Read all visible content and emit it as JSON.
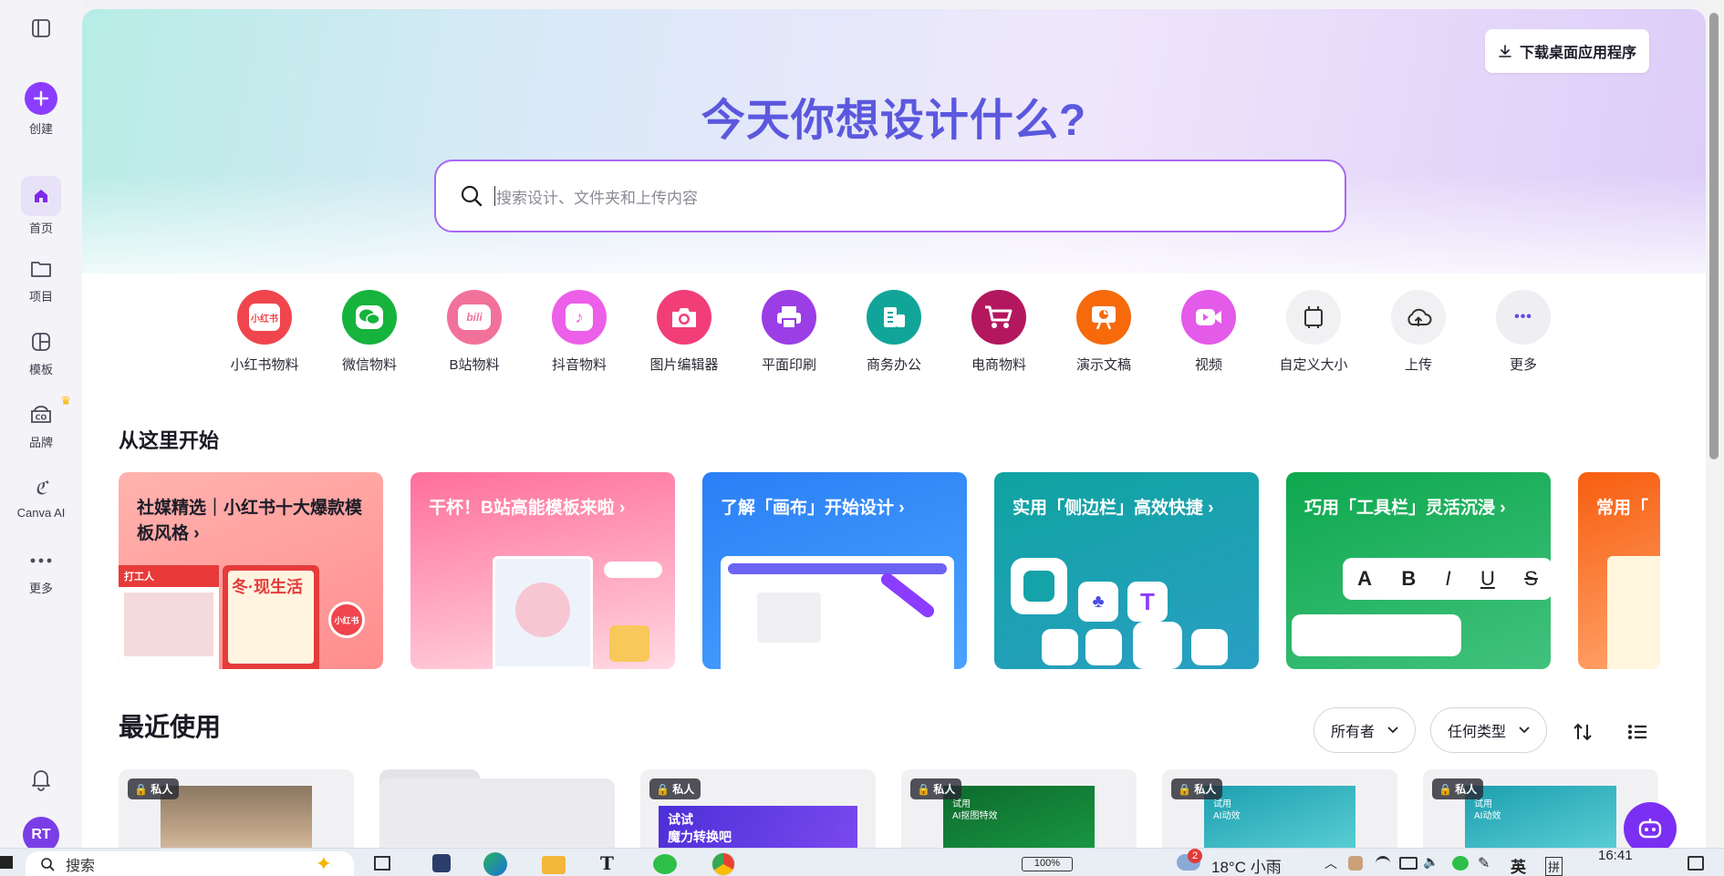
{
  "rail": {
    "create": "创建",
    "items": [
      {
        "label": "首页",
        "icon": "home-icon"
      },
      {
        "label": "项目",
        "icon": "folder-icon"
      },
      {
        "label": "模板",
        "icon": "template-icon"
      },
      {
        "label": "品牌",
        "icon": "brand-icon"
      },
      {
        "label": "Canva AI",
        "icon": "canva-ai-icon"
      },
      {
        "label": "更多",
        "icon": "more-icon"
      }
    ],
    "avatar": "RT"
  },
  "header": {
    "download_label": "下载桌面应用程序",
    "title": "今天你想设计什么?",
    "search_placeholder": "搜索设计、文件夹和上传内容"
  },
  "categories": [
    {
      "label": "小红书物料",
      "color": "#f0454d",
      "icon": "xiaohongshu-icon",
      "glyph": "小红书"
    },
    {
      "label": "微信物料",
      "color": "#16b33d",
      "icon": "wechat-icon",
      "glyph": ""
    },
    {
      "label": "B站物料",
      "color": "#f2719a",
      "icon": "bilibili-icon",
      "glyph": "bili"
    },
    {
      "label": "抖音物料",
      "color": "#ec5fe8",
      "icon": "douyin-icon",
      "glyph": "♪"
    },
    {
      "label": "图片编辑器",
      "color": "#f23e78",
      "icon": "camera-icon",
      "glyph": ""
    },
    {
      "label": "平面印刷",
      "color": "#9b3ee6",
      "icon": "printer-icon",
      "glyph": ""
    },
    {
      "label": "商务办公",
      "color": "#11a59a",
      "icon": "office-icon",
      "glyph": ""
    },
    {
      "label": "电商物料",
      "color": "#b3185e",
      "icon": "cart-icon",
      "glyph": ""
    },
    {
      "label": "演示文稿",
      "color": "#f66a0b",
      "icon": "presentation-icon",
      "glyph": ""
    },
    {
      "label": "视频",
      "color": "#e45ae9",
      "icon": "video-icon",
      "glyph": ""
    },
    {
      "label": "自定义大小",
      "color": "#f1f1f3",
      "icon": "crop-icon",
      "glyph": ""
    },
    {
      "label": "上传",
      "color": "#f1f1f3",
      "icon": "cloud-upload-icon",
      "glyph": ""
    },
    {
      "label": "更多",
      "color": "#eeeef3",
      "icon": "more-icon",
      "glyph": "•••"
    }
  ],
  "start": {
    "title": "从这里开始",
    "cards": [
      {
        "title": "社媒精选｜小红书十大爆款模板风格 ›",
        "bg": "#ff8e8e"
      },
      {
        "title": "干杯！B站高能模板来啦 ›",
        "bg": "#ff6b9a"
      },
      {
        "title": "了解「画布」开始设计 ›",
        "bg": "#2b86f7"
      },
      {
        "title": "实用「侧边栏」高效快捷 ›",
        "bg": "#13a3a8"
      },
      {
        "title": "巧用「工具栏」灵活沉浸 ›",
        "bg": "#1bb05a"
      },
      {
        "title": "常用「",
        "bg": "#f96a1a"
      }
    ],
    "card_decor": {
      "xhs_a": "打工人",
      "xhs_b": "冬·现生活",
      "xhs_c": "小红书",
      "toolbar": [
        "A",
        "B",
        "I",
        "U",
        "S"
      ]
    }
  },
  "recent": {
    "title": "最近使用",
    "filters": [
      "所有者",
      "任何类型"
    ],
    "private_badge": "私人",
    "items": [
      {
        "type": "cat-photo",
        "badge": true,
        "text1": "",
        "text2": ""
      },
      {
        "type": "folder",
        "badge": false,
        "text1": "",
        "text2": ""
      },
      {
        "type": "design",
        "badge": true,
        "text1": "试试",
        "text2": "魔力转换吧"
      },
      {
        "type": "design",
        "badge": true,
        "text1": "试用",
        "text2": "AI抠图特效"
      },
      {
        "type": "design",
        "badge": true,
        "text1": "试用",
        "text2": "AI动效"
      },
      {
        "type": "design",
        "badge": true,
        "text1": "试用",
        "text2": "AI动效"
      }
    ]
  },
  "taskbar": {
    "search": "搜索",
    "battery": "100%",
    "weather": "18°C 小雨",
    "ime": "英",
    "ime2": "拼",
    "time": "16:41",
    "notif_count": "2"
  }
}
